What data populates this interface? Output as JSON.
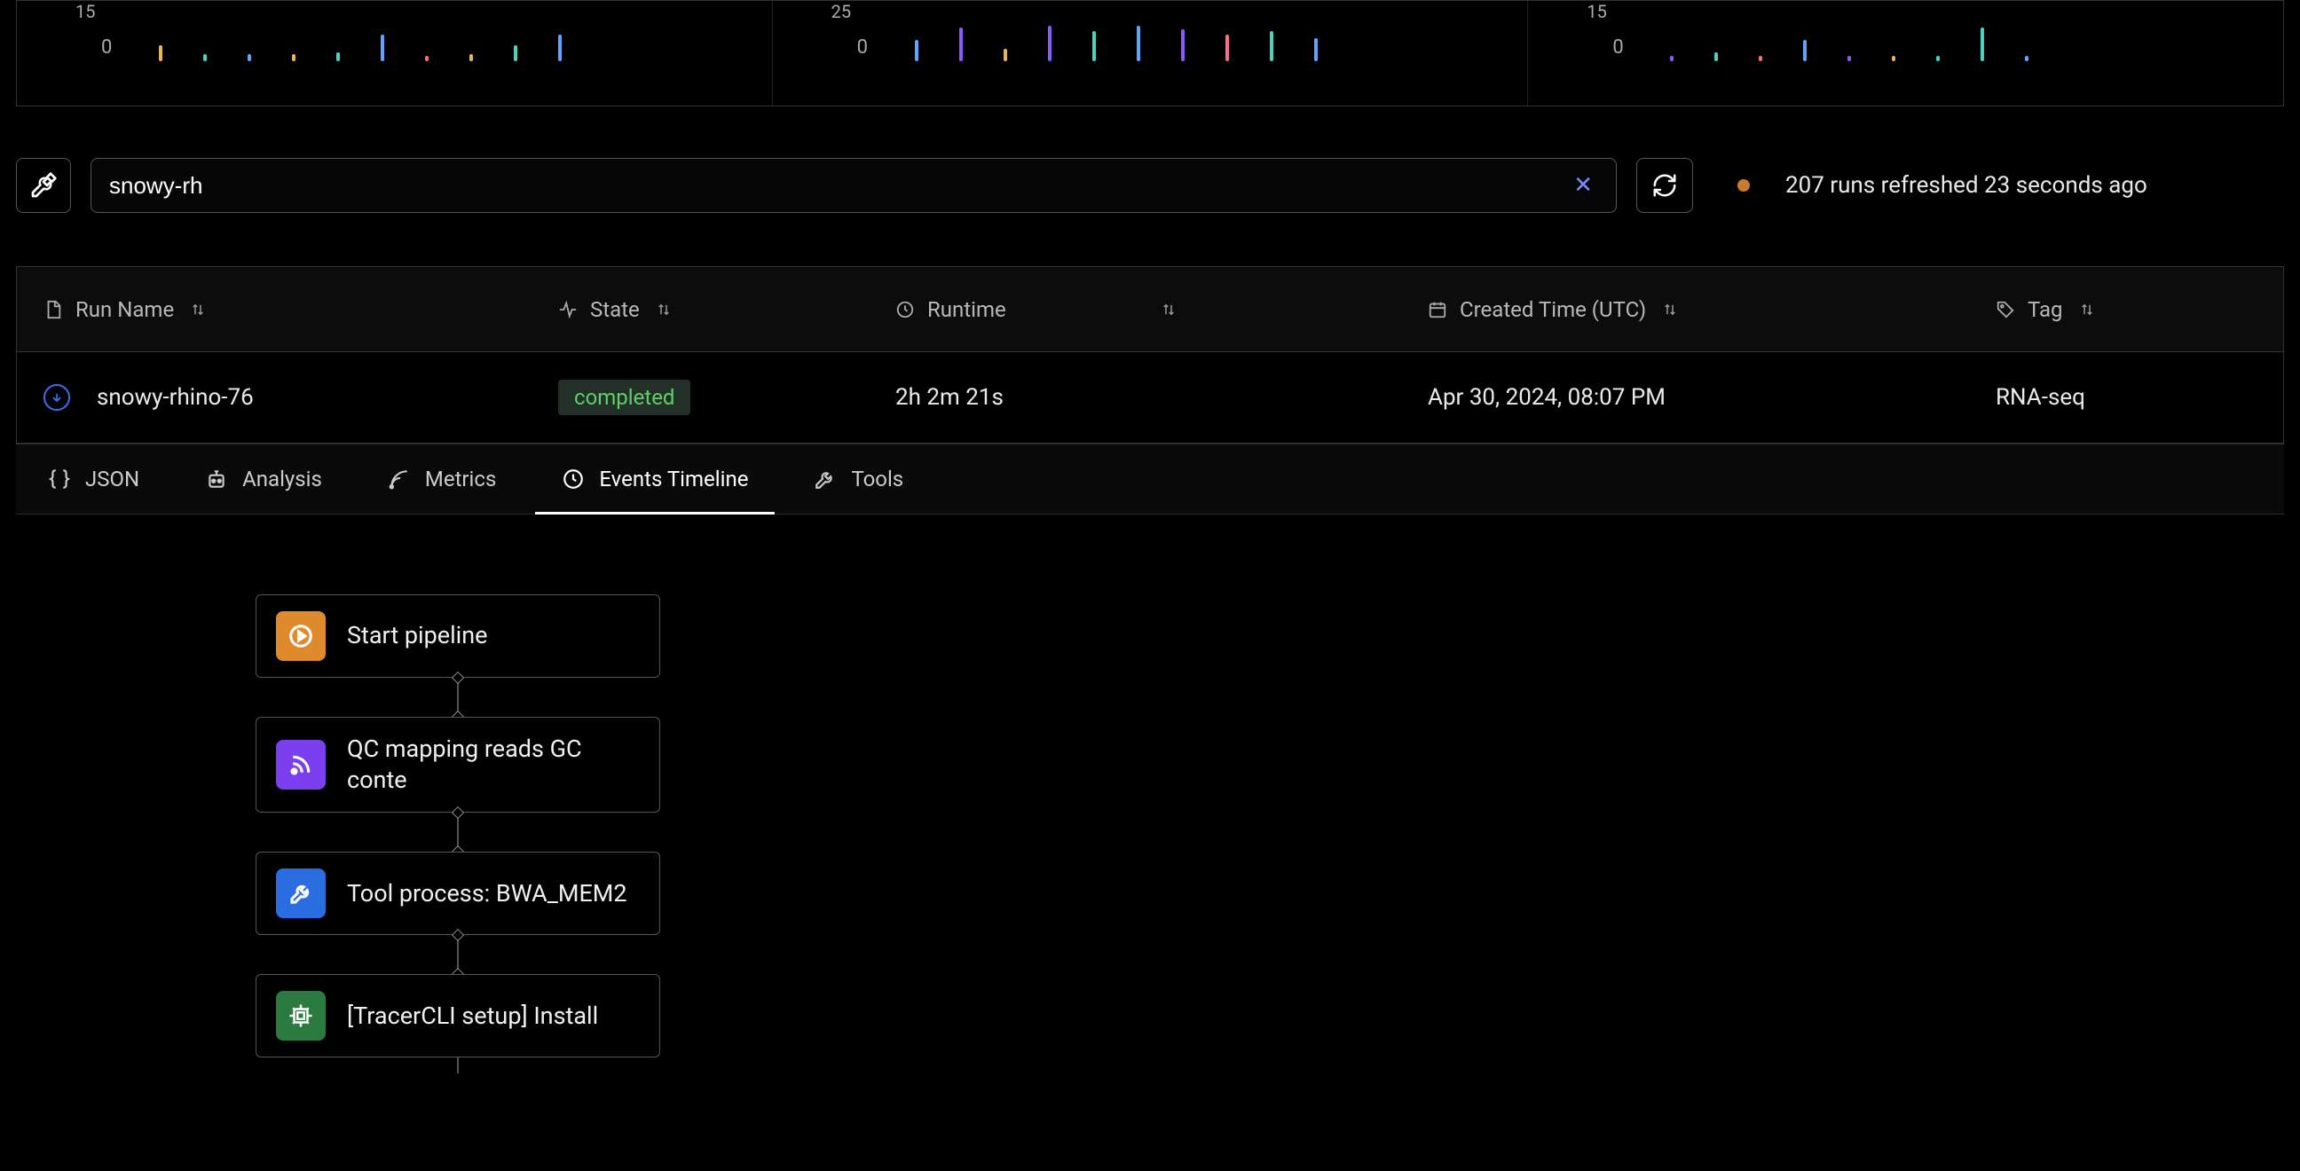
{
  "minicharts": [
    {
      "ytop": "15",
      "yzero": "0",
      "bars": [
        {
          "h": 18,
          "c": "#e7b84d"
        },
        {
          "h": 8,
          "c": "#4dd2c0"
        },
        {
          "h": 8,
          "c": "#5aa6ff"
        },
        {
          "h": 8,
          "c": "#e7b84d"
        },
        {
          "h": 10,
          "c": "#4dd2c0"
        },
        {
          "h": 30,
          "c": "#5aa6ff"
        },
        {
          "h": 6,
          "c": "#ff6b6b"
        },
        {
          "h": 8,
          "c": "#e7b84d"
        },
        {
          "h": 18,
          "c": "#4dd2c0"
        },
        {
          "h": 30,
          "c": "#5aa6ff"
        }
      ]
    },
    {
      "ytop": "25",
      "yzero": "0",
      "bars": [
        {
          "h": 24,
          "c": "#5aa6ff"
        },
        {
          "h": 38,
          "c": "#8a5aff"
        },
        {
          "h": 14,
          "c": "#e7b84d"
        },
        {
          "h": 40,
          "c": "#8a5aff"
        },
        {
          "h": 34,
          "c": "#4dd2c0"
        },
        {
          "h": 40,
          "c": "#5aa6ff"
        },
        {
          "h": 36,
          "c": "#8a5aff"
        },
        {
          "h": 30,
          "c": "#ff6b8a"
        },
        {
          "h": 34,
          "c": "#4dd2c0"
        },
        {
          "h": 26,
          "c": "#5aa6ff"
        }
      ]
    },
    {
      "ytop": "15",
      "yzero": "0",
      "bars": [
        {
          "h": 6,
          "c": "#8a5aff"
        },
        {
          "h": 10,
          "c": "#4dd2c0"
        },
        {
          "h": 6,
          "c": "#ff6b6b"
        },
        {
          "h": 24,
          "c": "#5aa6ff"
        },
        {
          "h": 6,
          "c": "#8a5aff"
        },
        {
          "h": 6,
          "c": "#e7b84d"
        },
        {
          "h": 6,
          "c": "#4dd2c0"
        },
        {
          "h": 38,
          "c": "#4dd2c0"
        },
        {
          "h": 6,
          "c": "#5aa6ff"
        }
      ]
    }
  ],
  "search": {
    "value": "snowy-rh"
  },
  "status": {
    "text": "207 runs refreshed 23 seconds ago"
  },
  "columns": {
    "run_name": "Run Name",
    "state": "State",
    "runtime": "Runtime",
    "created": "Created Time (UTC)",
    "tag": "Tag"
  },
  "row": {
    "name": "snowy-rhino-76",
    "state": "completed",
    "runtime": "2h 2m 21s",
    "created": "Apr 30, 2024, 08:07 PM",
    "tag": "RNA-seq"
  },
  "tabs": {
    "json": "JSON",
    "analysis": "Analysis",
    "metrics": "Metrics",
    "events": "Events Timeline",
    "tools": "Tools"
  },
  "timeline": [
    {
      "icon": "play",
      "color": "ic-orange",
      "label": "Start pipeline"
    },
    {
      "icon": "rss",
      "color": "ic-purple",
      "label": "QC mapping reads GC conte"
    },
    {
      "icon": "wrench",
      "color": "ic-blue",
      "label": "Tool process: BWA_MEM2"
    },
    {
      "icon": "chip",
      "color": "ic-green",
      "label": "[TracerCLI setup] Install"
    }
  ]
}
